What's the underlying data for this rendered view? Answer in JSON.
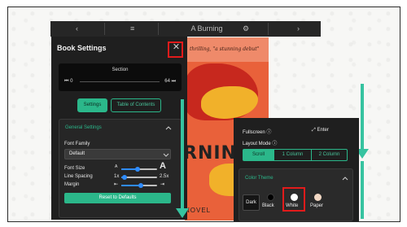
{
  "topbar": {
    "title": "A Burning",
    "back_icon": "chevron-left-icon",
    "menu_icon": "menu-icon",
    "gear_icon": "gear-icon",
    "forward_icon": "chevron-right-icon"
  },
  "cover": {
    "quote": "thrilling, \"a stunning debut\"",
    "title": "RNING",
    "subtitle": "NOVEL"
  },
  "settings_panel": {
    "title": "Book Settings",
    "close_icon": "close-icon",
    "section": {
      "label": "Section",
      "min": "0",
      "max": "64",
      "start_icon": "skip-back-icon",
      "end_icon": "skip-forward-icon"
    },
    "tabs": [
      {
        "label": "Settings",
        "active": true
      },
      {
        "label": "Table of Contents",
        "active": false
      }
    ],
    "general": {
      "title": "General Settings",
      "font_family_label": "Font Family",
      "font_family_value": "Default",
      "font_size_label": "Font Size",
      "font_size_small": "A",
      "font_size_large": "A",
      "font_size_level": 0.45,
      "line_spacing_label": "Line Spacing",
      "line_spacing_min": "1x",
      "line_spacing_max": "2.5x",
      "line_spacing_level": 0.1,
      "margin_label": "Margin",
      "margin_level": 0.55,
      "reset_label": "Reset to Defaults"
    }
  },
  "layout_panel": {
    "fullscreen_label": "Fullscreen",
    "enter_label": "Enter",
    "layout_mode_label": "Layout Mode",
    "modes": [
      {
        "label": "Scroll",
        "active": true
      },
      {
        "label": "1 Column",
        "active": false
      },
      {
        "label": "2 Column",
        "active": false
      }
    ],
    "color_theme": {
      "title": "Color Theme",
      "options": [
        {
          "label": "Dark",
          "color": "#151515"
        },
        {
          "label": "Black",
          "color": "#000000"
        },
        {
          "label": "White",
          "color": "#ffffff",
          "selected": true
        },
        {
          "label": "Paper",
          "color": "#f2d8c4"
        }
      ]
    }
  },
  "colors": {
    "accent": "#2bb78a",
    "highlight": "#e21b1b",
    "arrow": "#36c3a0",
    "panel_bg": "#1f1f1f"
  }
}
